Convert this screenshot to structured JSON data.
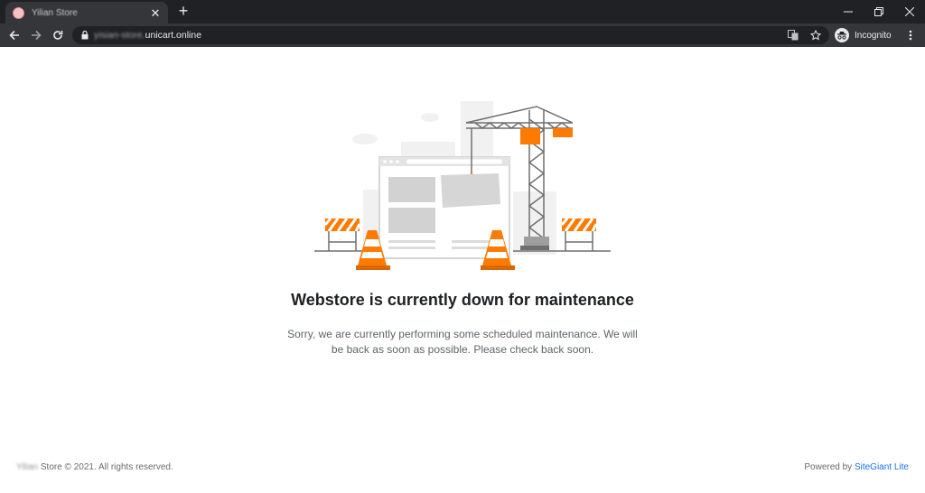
{
  "browser": {
    "tab_title": "Yilian Store",
    "url_blurred": "yisian-store.",
    "url_domain": "unicart.online",
    "incognito_label": "Incognito"
  },
  "icons": {
    "favicon": "store-favicon-icon",
    "tab_close": "close-icon",
    "new_tab": "plus-icon",
    "minimize": "minimize-icon",
    "restore": "restore-icon",
    "close_window": "close-window-icon",
    "back": "arrow-left-icon",
    "forward": "arrow-right-icon",
    "reload": "reload-icon",
    "lock": "lock-icon",
    "translate": "translate-icon",
    "bookmark": "star-icon",
    "incognito": "incognito-icon",
    "menu": "kebab-menu-icon"
  },
  "main": {
    "headline": "Webstore is currently down for maintenance",
    "message": "Sorry, we are currently performing some scheduled maintenance. We will be back as soon as possible. Please check back soon."
  },
  "footer": {
    "store_name_blurred": "Yilian",
    "copyright": " Store © 2021. All rights reserved.",
    "powered_prefix": "Powered by ",
    "powered_link": "SiteGiant Lite"
  },
  "colors": {
    "accent_orange": "#ff7a00",
    "link_blue": "#1a73e8",
    "chrome_dark": "#202124",
    "chrome_toolbar": "#35363a"
  }
}
